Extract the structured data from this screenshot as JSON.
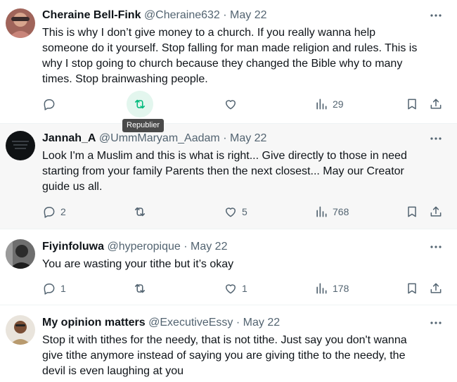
{
  "tooltip": "Republier",
  "tweets": [
    {
      "name": "Cheraine Bell-Fink",
      "handle": "@Cheraine632",
      "date": "May 22",
      "lines": [
        "This is why I don’t give money to a church. If you really wanna help",
        "someone do it yourself. Stop falling for man made religion and rules.  This is",
        "why I stop going to church because they changed the Bible why to many",
        "times. Stop brainwashing people."
      ],
      "replies": "",
      "reposts": "",
      "likes": "",
      "views": "29"
    },
    {
      "name": "Jannah_A",
      "handle": "@UmmMaryam_Aadam",
      "date": "May 22",
      "lines": [
        "Look I'm a Muslim and this is what is right... Give directly to those in need",
        "starting from your family Parents then the next closest... May our Creator",
        "guide us all."
      ],
      "replies": "2",
      "reposts": "",
      "likes": "5",
      "views": "768"
    },
    {
      "name": "Fiyinfoluwa",
      "handle": "@hyperopique",
      "date": "May 22",
      "lines": [
        "You are wasting your tithe but it’s okay"
      ],
      "replies": "1",
      "reposts": "",
      "likes": "1",
      "views": "178"
    },
    {
      "name": "My opinion matters",
      "handle": "@ExecutiveEssy",
      "date": "May 22",
      "lines": [
        "Stop it with tithes for the needy, that is not tithe. Just say you don't wanna",
        "give tithe anymore instead of saying you are giving tithe to the needy, the",
        "devil is even laughing at you"
      ],
      "replies": "",
      "reposts": "",
      "likes": "",
      "views": ""
    }
  ],
  "icons": {
    "reply": "reply-icon",
    "repost": "repost-icon",
    "like": "like-icon",
    "views": "views-icon",
    "bookmark": "bookmark-icon",
    "share": "share-icon",
    "more": "more-icon"
  },
  "colors": {
    "text": "#0f1419",
    "secondary": "#536471",
    "repost_active": "#00ba7c",
    "repost_highlight_bg": "#e3f6ee",
    "hover_bg": "#f7f7f7",
    "tooltip_bg": "#4a4a4a"
  }
}
